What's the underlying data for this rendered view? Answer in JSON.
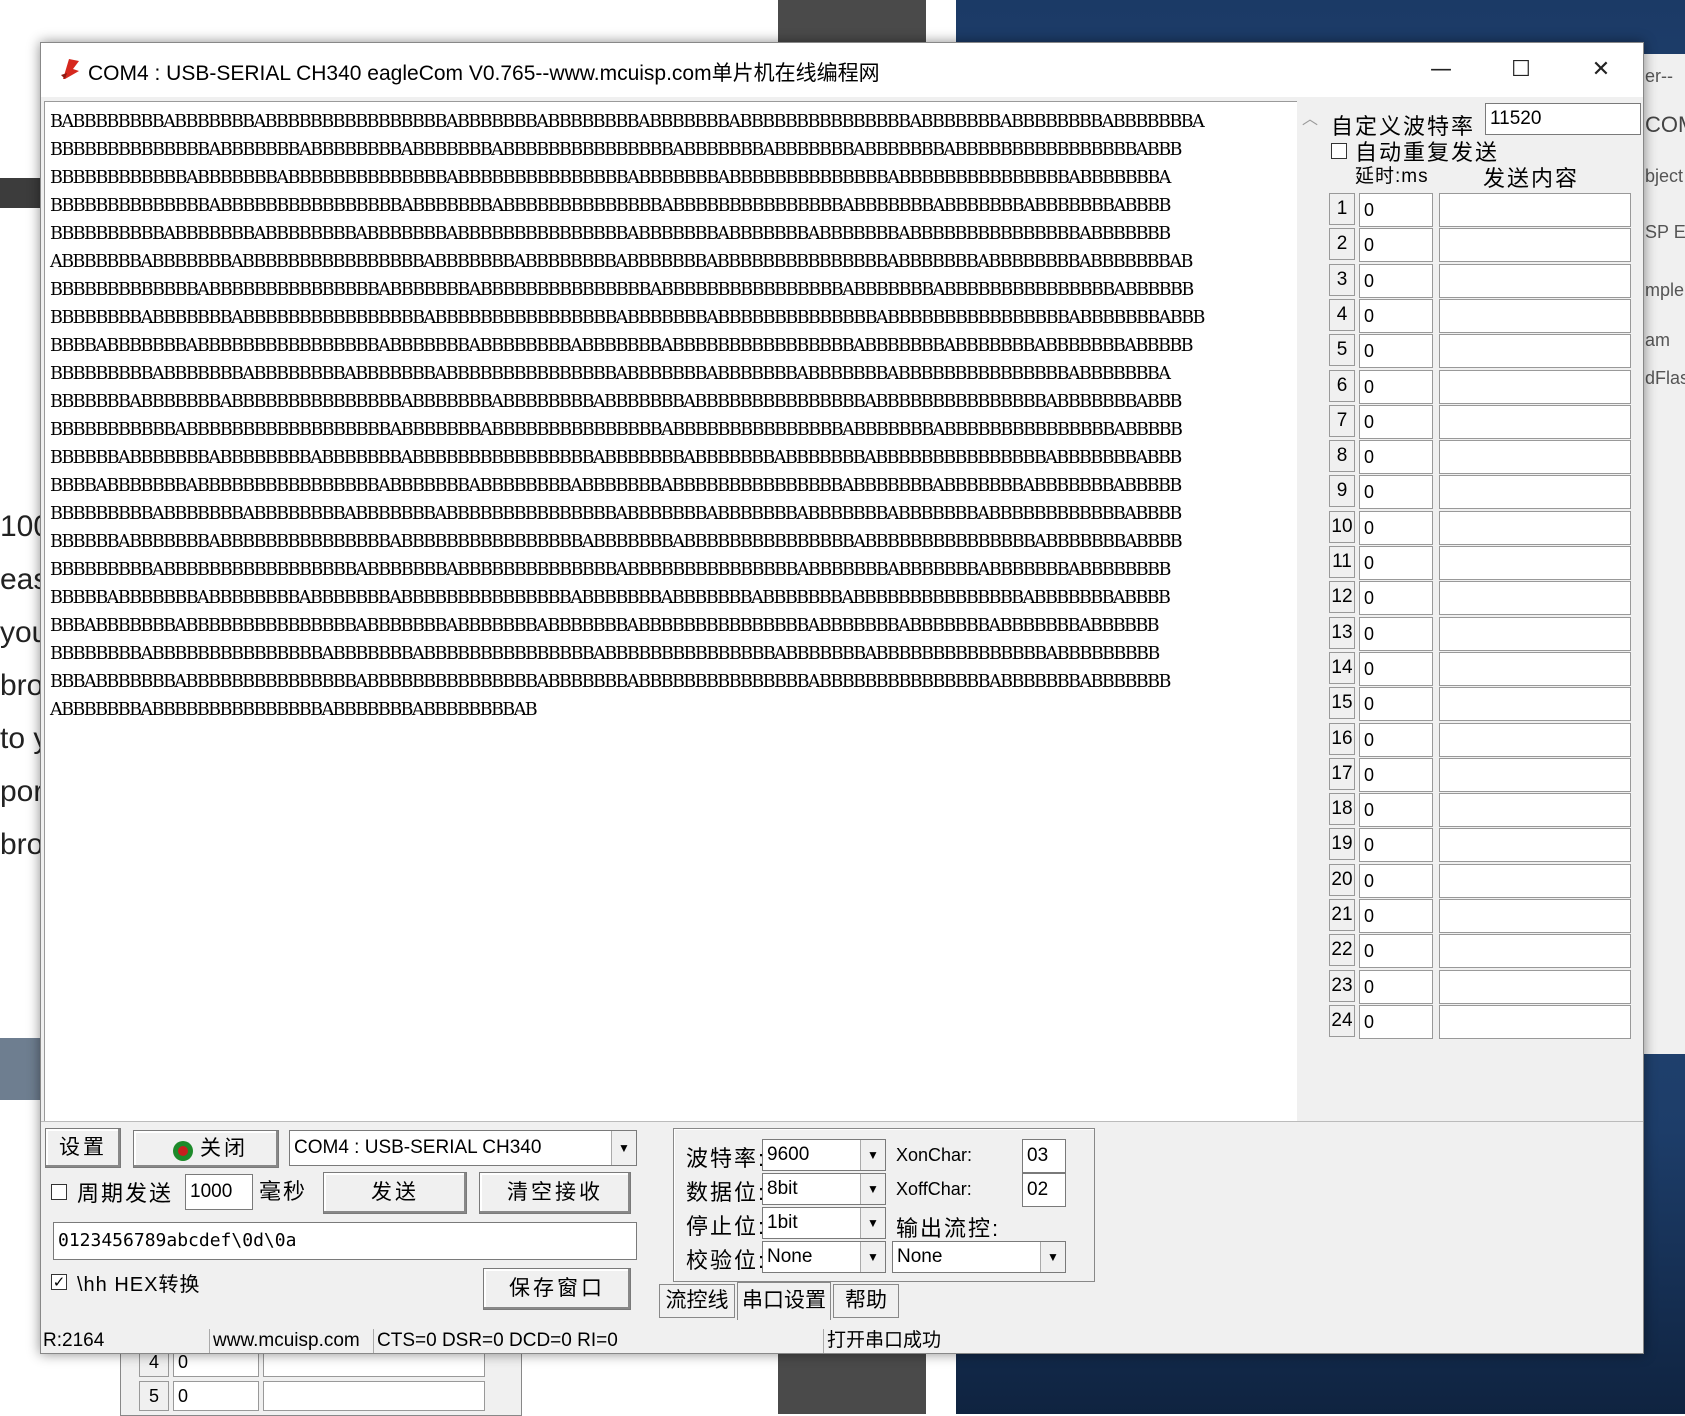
{
  "window": {
    "title": "COM4 : USB-SERIAL CH340  eagleCom V0.765--www.mcuisp.com单片机在线编程网",
    "minimize_glyph": "—",
    "maximize_glyph": "☐",
    "close_glyph": "✕"
  },
  "receive": {
    "lines": [
      "BABBBBBBBBABBBBBBBABBBBBBBBBBBBBBBBABBBBBBBABBBBBBBBABBBBBBBABBBBBBBBBBBBBBBABBBBBBBABBBBBBBBABBBBBBBA",
      "BBBBBBBBBBBBBBABBBBBBBABBBBBBBBABBBBBBBABBBBBBBBBBBBBBBABBBBBBBABBBBBBBABBBBBBBABBBBBBBBBBBBBBBBABBB",
      "BBBBBBBBBBBBABBBBBBBABBBBBBBBBBBBBBABBBBBBBBBBBBBBBABBBBBBBABBBBBBBBBBBBBBABBBBBBBBBBBBBBBABBBBBBBA",
      "BBBBBBBBBBBBBBABBBBBBBBBBBBBBBBABBBBBBBABBBBBBBBBBBBBBABBBBBBBBBBBBBBBABBBBBBBABBBBBBBABBBBBBBABBBB",
      "BBBBBBBBBBABBBBBBBABBBBBBBBABBBBBBBABBBBBBBBBBBBBBBABBBBBBBABBBBBBBABBBBBBBABBBBBBBBBBBBBBBABBBBBBB",
      "ABBBBBBBABBBBBBBABBBBBBBBBBBBBBBBABBBBBBBABBBBBBBBABBBBBBBABBBBBBBBBBBBBBBABBBBBBBABBBBBBBBABBBBBBBAB",
      "BBBBBBBBBBBBBABBBBBBBBBBBBBBBABBBBBBBABBBBBBBBBBBBBBBABBBBBBBBBBBBBBBBABBBBBBBABBBBBBBBBBBBBBBABBBBBB",
      "BBBBBBBBABBBBBBBABBBBBBBBBBBBBBBBABBBBBBBBBBBBBBBBABBBBBBBABBBBBBBBBBBBBBABBBBBBBBBBBBBBBBABBBBBBBABBB",
      "BBBBABBBBBBBABBBBBBBBBBBBBBBBABBBBBBBABBBBBBBBABBBBBBBABBBBBBBBBBBBBBBBABBBBBBBABBBBBBBABBBBBBBABBBBB",
      "BBBBBBBBBABBBBBBBABBBBBBBBABBBBBBBABBBBBBBBBBBBBBBABBBBBBBABBBBBBBABBBBBBBABBBBBBBBBBBBBBBABBBBBBBA",
      "BBBBBBBABBBBBBBABBBBBBBBBBBBBBBABBBBBBBABBBBBBBBABBBBBBBABBBBBBBBBBBBBBBABBBBBBBBBBBBBBBABBBBBBBABBB",
      "BBBBBBBBBBBABBBBBBBBBBBBBBBBBBABBBBBBBABBBBBBBBBBBBBBBABBBBBBBBBBBBBBBABBBBBBBABBBBBBBBBBBBBBBABBBBB",
      "BBBBBBABBBBBBBABBBBBBBBABBBBBBBABBBBBBBBBBBBBBBBABBBBBBBABBBBBBBABBBBBBBABBBBBBBBBBBBBBBABBBBBBBABBB",
      "BBBBABBBBBBBABBBBBBBBBBBBBBBBABBBBBBBABBBBBBBBABBBBBBBABBBBBBBBBBBBBBBABBBBBBBABBBBBBBABBBBBBBABBBBB",
      "BBBBBBBBBABBBBBBBABBBBBBBBABBBBBBBABBBBBBBBBBBBBBBABBBBBBBABBBBBBBABBBBBBBABBBBBBBABBBBBBBBBBBBABBBB",
      "BBBBBBABBBBBBBABBBBBBBBBBBBBBBABBBBBBBBBBBBBBBBABBBBBBBABBBBBBBBBBBBBBBABBBBBBBBBBBBBBBABBBBBBBABBBB",
      "BBBBBBBBBABBBBBBBBBBBBBBBBBABBBBBBBABBBBBBBBBBBBBBABBBBBBBBBBBBBBBABBBBBBBABBBBBBBABBBBBBBABBBBBBBB",
      "BBBBBABBBBBBBABBBBBBBBABBBBBBBABBBBBBBBBBBBBBBABBBBBBBABBBBBBBABBBBBBBABBBBBBBBBBBBBBBABBBBBBBABBBB",
      "BBBABBBBBBBABBBBBBBBBBBBBBBABBBBBBBABBBBBBBABBBBBBBABBBBBBBBBBBBBBBABBBBBBBABBBBBBBABBBBBBBABBBBBB",
      "BBBBBBBBABBBBBBBBBBBBBBBABBBBBBBABBBBBBBBBBBBBBBABBBBBBBBBBBBBBBABBBBBBBABBBBBBBBBBBBBBBABBBBBBBBB",
      "BBBABBBBBBBABBBBBBBBBBBBBBBABBBBBBBBBBBBBBBABBBBBBBABBBBBBBBBBBBBBBABBBBBBBBBBBBBBBABBBBBBBABBBBBBB",
      "ABBBBBBBABBBBBBBBBBBBBBBABBBBBBBABBBBBBBBAB"
    ]
  },
  "right_panel": {
    "custom_baud_label": "自定义波特率",
    "custom_baud_value": "11520",
    "auto_repeat_label": "自动重复发送",
    "delay_header": "延时:ms",
    "content_header": "发送内容",
    "rows": [
      {
        "n": "1",
        "d": "0"
      },
      {
        "n": "2",
        "d": "0"
      },
      {
        "n": "3",
        "d": "0"
      },
      {
        "n": "4",
        "d": "0"
      },
      {
        "n": "5",
        "d": "0"
      },
      {
        "n": "6",
        "d": "0"
      },
      {
        "n": "7",
        "d": "0"
      },
      {
        "n": "8",
        "d": "0"
      },
      {
        "n": "9",
        "d": "0"
      },
      {
        "n": "10",
        "d": "0"
      },
      {
        "n": "11",
        "d": "0"
      },
      {
        "n": "12",
        "d": "0"
      },
      {
        "n": "13",
        "d": "0"
      },
      {
        "n": "14",
        "d": "0"
      },
      {
        "n": "15",
        "d": "0"
      },
      {
        "n": "16",
        "d": "0"
      },
      {
        "n": "17",
        "d": "0"
      },
      {
        "n": "18",
        "d": "0"
      },
      {
        "n": "19",
        "d": "0"
      },
      {
        "n": "20",
        "d": "0"
      },
      {
        "n": "21",
        "d": "0"
      },
      {
        "n": "22",
        "d": "0"
      },
      {
        "n": "23",
        "d": "0"
      },
      {
        "n": "24",
        "d": "0"
      }
    ]
  },
  "controls": {
    "settings_button": "设置",
    "close_port_button": "关闭",
    "port_select": "COM4 : USB-SERIAL CH340",
    "periodic_send_label": "周期发送",
    "period_value": "1000",
    "ms_label": "毫秒",
    "send_button": "发送",
    "clear_button": "清空接收",
    "send_text": "0123456789abcdef\\0d\\0a",
    "hex_label": "\\hh HEX转换",
    "save_button": "保存窗口"
  },
  "serial": {
    "baud_label": "波特率:",
    "baud_value": "9600",
    "databits_label": "数据位:",
    "databits_value": "8bit",
    "stopbits_label": "停止位:",
    "stopbits_value": "1bit",
    "parity_label": "校验位:",
    "parity_value": "None",
    "xon_label": "XonChar:",
    "xon_value": "03",
    "xoff_label": "XoffChar:",
    "xoff_value": "02",
    "flow_label": "输出流控:",
    "flow_value": "None"
  },
  "tabs": {
    "flow": "流控线",
    "serial": "串口设置",
    "help": "帮助"
  },
  "status": {
    "received": "R:2164",
    "site": "www.mcuisp.com",
    "lines": "CTS=0 DSR=0 DCD=0 RI=0",
    "message": "打开串口成功"
  },
  "background": {
    "text_lines": [
      "100",
      "eas",
      "you",
      "bro",
      "to y",
      "pora",
      "bro"
    ],
    "right_win": [
      "er--",
      "COM",
      "bject",
      "SP  E",
      "mple",
      "am",
      "dFlas"
    ],
    "lower_rows": [
      {
        "n": "4",
        "d": "0"
      },
      {
        "n": "5",
        "d": "0"
      }
    ]
  }
}
